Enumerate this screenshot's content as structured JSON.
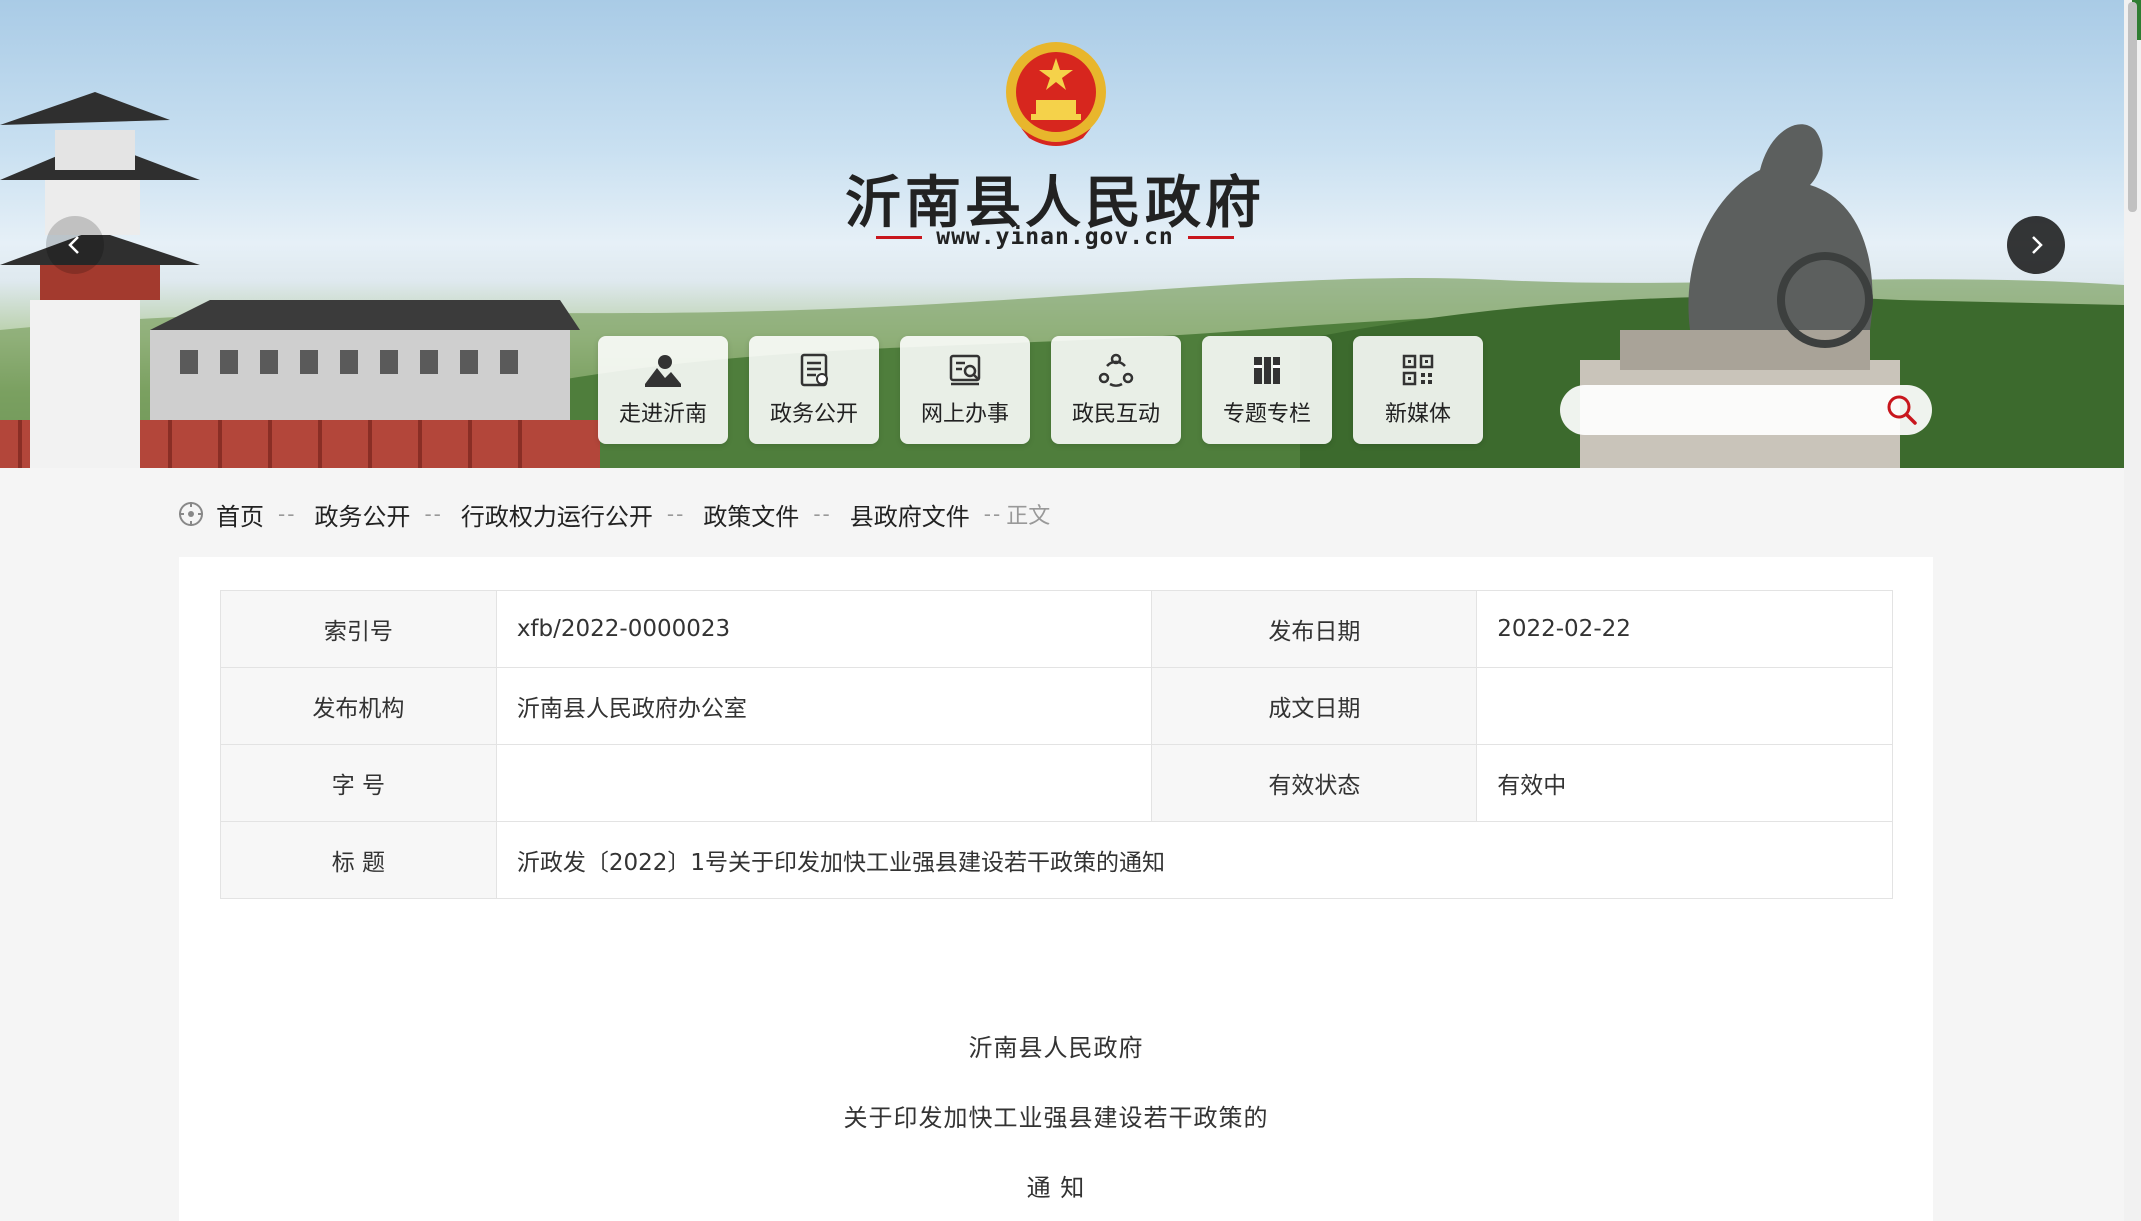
{
  "banner": {
    "site_title": "沂南县人民政府",
    "site_url": "www.yinan.gov.cn",
    "quick_links": [
      {
        "label": "走进沂南",
        "icon": "landscape-icon"
      },
      {
        "label": "政务公开",
        "icon": "document-icon"
      },
      {
        "label": "网上办事",
        "icon": "search-document-icon"
      },
      {
        "label": "政民互动",
        "icon": "interaction-icon"
      },
      {
        "label": "专题专栏",
        "icon": "books-icon"
      },
      {
        "label": "新媒体",
        "icon": "qr-code-icon"
      }
    ],
    "search": {
      "placeholder": "",
      "value": ""
    }
  },
  "breadcrumb": {
    "items": [
      "首页",
      "政务公开",
      "行政权力运行公开",
      "政策文件",
      "县政府文件"
    ],
    "separator": "--",
    "current": "正文"
  },
  "meta_table": {
    "index_label": "索引号",
    "index_value": "xfb/2022-0000023",
    "pubdate_label": "发布日期",
    "pubdate_value": "2022-02-22",
    "agency_label": "发布机构",
    "agency_value": "沂南县人民政府办公室",
    "writedate_label": "成文日期",
    "writedate_value": "",
    "docno_label": "字 号",
    "docno_value": "",
    "status_label": "有效状态",
    "status_value": "有效中",
    "title_label": "标 题",
    "title_value": "沂政发〔2022〕1号关于印发加快工业强县建设若干政策的通知"
  },
  "document": {
    "line1": "沂南县人民政府",
    "line2": "关于印发加快工业强县建设若干政策的",
    "line3": "通 知"
  },
  "colors": {
    "accent_red": "#c8161d",
    "emblem_gold": "#e8b62c",
    "text": "#333333"
  }
}
